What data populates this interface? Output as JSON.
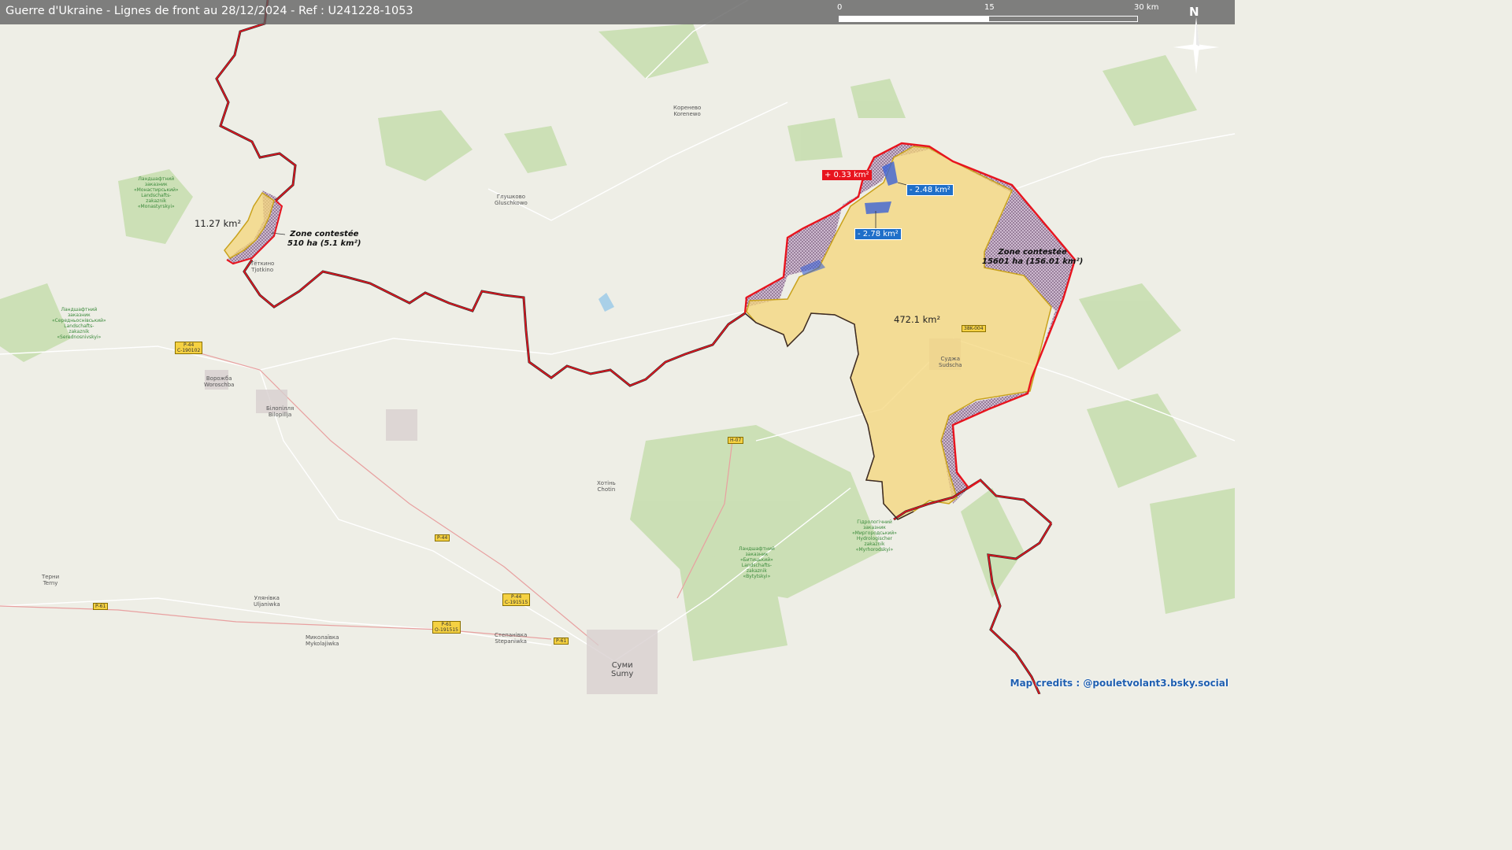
{
  "header": {
    "title": "Guerre d'Ukraine - Lignes de front au 28/12/2024 - Ref : U241228-1053"
  },
  "scale_bar": {
    "labels": [
      "0",
      "15",
      "30 km"
    ]
  },
  "compass": {
    "label": "N",
    "icon": "compass-rose-icon"
  },
  "changes": {
    "gain": "+ 0.33 km²",
    "loss_1": "- 2.48 km²",
    "loss_2": "- 2.78 km²"
  },
  "areas": {
    "west_occupied": "11.27 km²",
    "east_occupied": "472.1 km²"
  },
  "zones": {
    "west": {
      "line1": "Zone contestée",
      "line2": "510 ha (5.1 km²)"
    },
    "east": {
      "line1": "Zone contestée",
      "line2": "15601 ha (156.01 km²)"
    }
  },
  "towns": {
    "korenevo": {
      "cyr": "Коренево",
      "lat": "Korenewo"
    },
    "glushkovo": {
      "cyr": "Глушково",
      "lat": "Gluschkowo"
    },
    "tyotkino": {
      "cyr": "Тёткино",
      "lat": "Tjotkino"
    },
    "sudzha": {
      "cyr": "Суджа",
      "lat": "Sudscha"
    },
    "vorozhba": {
      "cyr": "Ворожба",
      "lat": "Woroschba"
    },
    "bilopillia": {
      "cyr": "Білопілля",
      "lat": "Bilopillja"
    },
    "khotin": {
      "cyr": "Хотінь",
      "lat": "Chotin"
    },
    "terny": {
      "cyr": "Терни",
      "lat": "Terny"
    },
    "ulyanivka": {
      "cyr": "Улянівка",
      "lat": "Uljaniwka"
    },
    "mykolaivka": {
      "cyr": "Миколаївка",
      "lat": "Mykolajiwka"
    },
    "stepanivka": {
      "cyr": "Степанівка",
      "lat": "Stepaniwka"
    },
    "sumy": {
      "cyr": "Суми",
      "lat": "Sumy"
    }
  },
  "roads": {
    "p44_c190102": {
      "l1": "P-44",
      "l2": "C-190102"
    },
    "h07": {
      "l1": "H-07"
    },
    "p44": {
      "l1": "P-44"
    },
    "p44_c191515": {
      "l1": "P-44",
      "l2": "C-191515"
    },
    "p61_o191515": {
      "l1": "P-61",
      "l2": "O-191515"
    },
    "p61_west": {
      "l1": "P-61"
    },
    "p61_east": {
      "l1": "P-61"
    },
    "38k004": {
      "l1": "38K-004"
    }
  },
  "parks": {
    "west_top": {
      "l1": "Ландшафтний",
      "l2": "заказник",
      "l3": "«Монастирський»",
      "l4": "Landschafts-",
      "l5": "zakaznik",
      "l6": "«Monastyrskyi»"
    },
    "west_mid": {
      "l1": "Ландшафтний",
      "l2": "заказник",
      "l3": "«Середньоснівський»",
      "l4": "Landschafts-",
      "l5": "zakaznik",
      "l6": "«Serednosnivskyi»"
    },
    "south_mid": {
      "l1": "Ландшафтний",
      "l2": "заказник",
      "l3": "«Битицький»",
      "l4": "Landschafts-",
      "l5": "zakaznik",
      "l6": "«Bytytskyi»"
    },
    "south_east": {
      "l1": "Гідрологічний",
      "l2": "заказник",
      "l3": "«Миргородський»",
      "l4": "Hydrologischer",
      "l5": "zakaznik",
      "l6": "«Myrhorodskyi»"
    }
  },
  "credits": "Map credits : @pouletvolant3.bsky.social",
  "colors": {
    "occupied_fill": "#f4d67a",
    "occupied_border": "#c9a21c",
    "front_line": "#e8141e",
    "contested_fill": "#c7b3c8",
    "loss_fill": "#3c63d4",
    "gain_label_bg": "#e8141e",
    "loss_label_bg": "#1f6fc9"
  }
}
